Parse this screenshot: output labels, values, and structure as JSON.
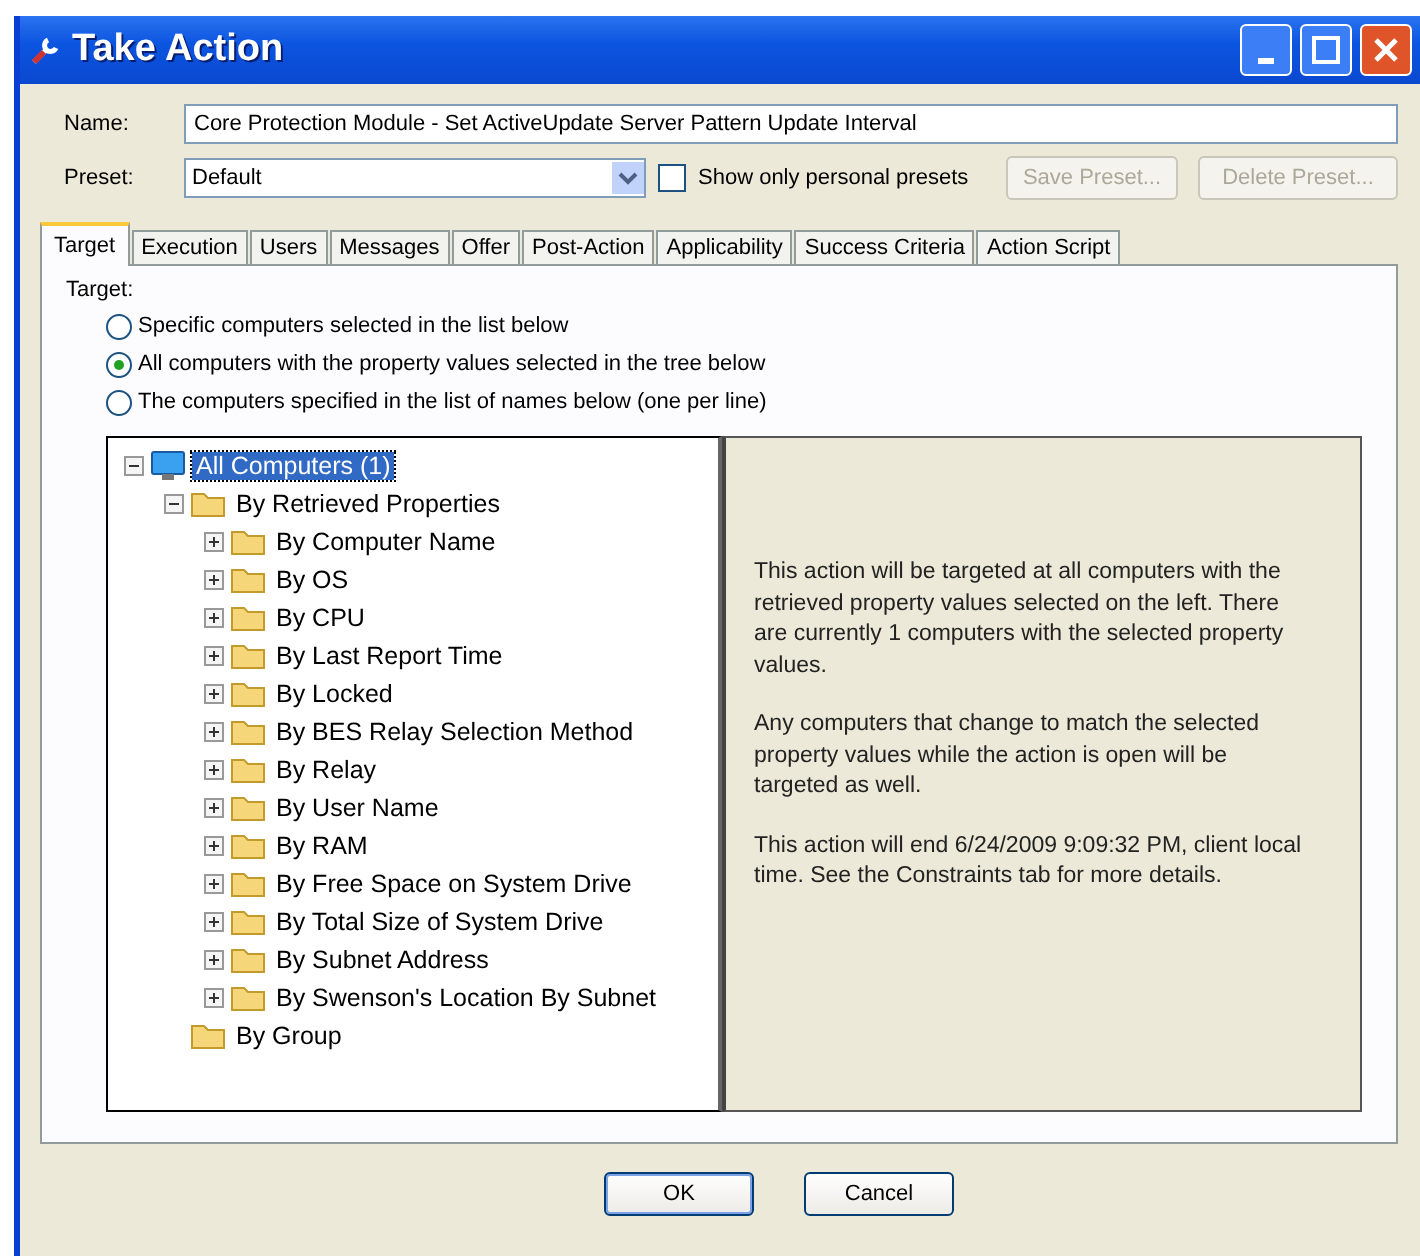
{
  "window": {
    "title": "Take Action"
  },
  "name_field": {
    "label": "Name:",
    "value": "Core Protection Module - Set ActiveUpdate Server Pattern Update Interval"
  },
  "preset": {
    "label": "Preset:",
    "value": "Default",
    "personal_only": {
      "label": "Show only personal presets",
      "checked": false
    },
    "buttons": [
      {
        "label": "Save Preset...",
        "disabled": true
      },
      {
        "label": "Delete Preset...",
        "disabled": true
      }
    ]
  },
  "tabs": [
    {
      "label": "Target",
      "selected": true
    },
    {
      "label": "Execution",
      "selected": false
    },
    {
      "label": "Users",
      "selected": false
    },
    {
      "label": "Messages",
      "selected": false
    },
    {
      "label": "Offer",
      "selected": false
    },
    {
      "label": "Post-Action",
      "selected": false
    },
    {
      "label": "Applicability",
      "selected": false
    },
    {
      "label": "Success Criteria",
      "selected": false
    },
    {
      "label": "Action Script",
      "selected": false
    }
  ],
  "target": {
    "label": "Target:",
    "options": [
      {
        "label": "Specific computers selected in the list below",
        "selected": false
      },
      {
        "label": "All computers with the property values selected in the tree below",
        "selected": true
      },
      {
        "label": "The computers specified in the list of names below (one per line)",
        "selected": false
      }
    ]
  },
  "tree": [
    {
      "label": "All Computers (1)",
      "kind": "computer",
      "expanded": true,
      "selected": true,
      "children": [
        {
          "label": "By Retrieved Properties",
          "kind": "folder",
          "expanded": true,
          "selected": false,
          "children": [
            {
              "label": "By Computer Name",
              "kind": "folder",
              "expanded": false,
              "selected": false
            },
            {
              "label": "By OS",
              "kind": "folder",
              "expanded": false,
              "selected": false
            },
            {
              "label": "By CPU",
              "kind": "folder",
              "expanded": false,
              "selected": false
            },
            {
              "label": "By Last Report Time",
              "kind": "folder",
              "expanded": false,
              "selected": false
            },
            {
              "label": "By Locked",
              "kind": "folder",
              "expanded": false,
              "selected": false
            },
            {
              "label": "By BES Relay Selection Method",
              "kind": "folder",
              "expanded": false,
              "selected": false
            },
            {
              "label": "By Relay",
              "kind": "folder",
              "expanded": false,
              "selected": false
            },
            {
              "label": "By User Name",
              "kind": "folder",
              "expanded": false,
              "selected": false
            },
            {
              "label": "By RAM",
              "kind": "folder",
              "expanded": false,
              "selected": false
            },
            {
              "label": "By Free Space on System Drive",
              "kind": "folder",
              "expanded": false,
              "selected": false
            },
            {
              "label": "By Total Size of System Drive",
              "kind": "folder",
              "expanded": false,
              "selected": false
            },
            {
              "label": "By Subnet Address",
              "kind": "folder",
              "expanded": false,
              "selected": false
            },
            {
              "label": "By Swenson's Location By Subnet",
              "kind": "folder",
              "expanded": false,
              "selected": false
            }
          ]
        },
        {
          "label": "By Group",
          "kind": "folder",
          "selected": false
        }
      ]
    }
  ],
  "info": [
    "This action will be targeted at all computers with the retrieved property values selected on the left. There are currently 1 computers with the selected property values.",
    "Any computers that change to match the selected property values while the action is open will be targeted as well.",
    "This action will end 6/24/2009 9:09:32 PM, client local time. See the Constraints tab for more details."
  ],
  "buttons": [
    {
      "label": "OK",
      "default": true
    },
    {
      "label": "Cancel",
      "default": false
    }
  ]
}
